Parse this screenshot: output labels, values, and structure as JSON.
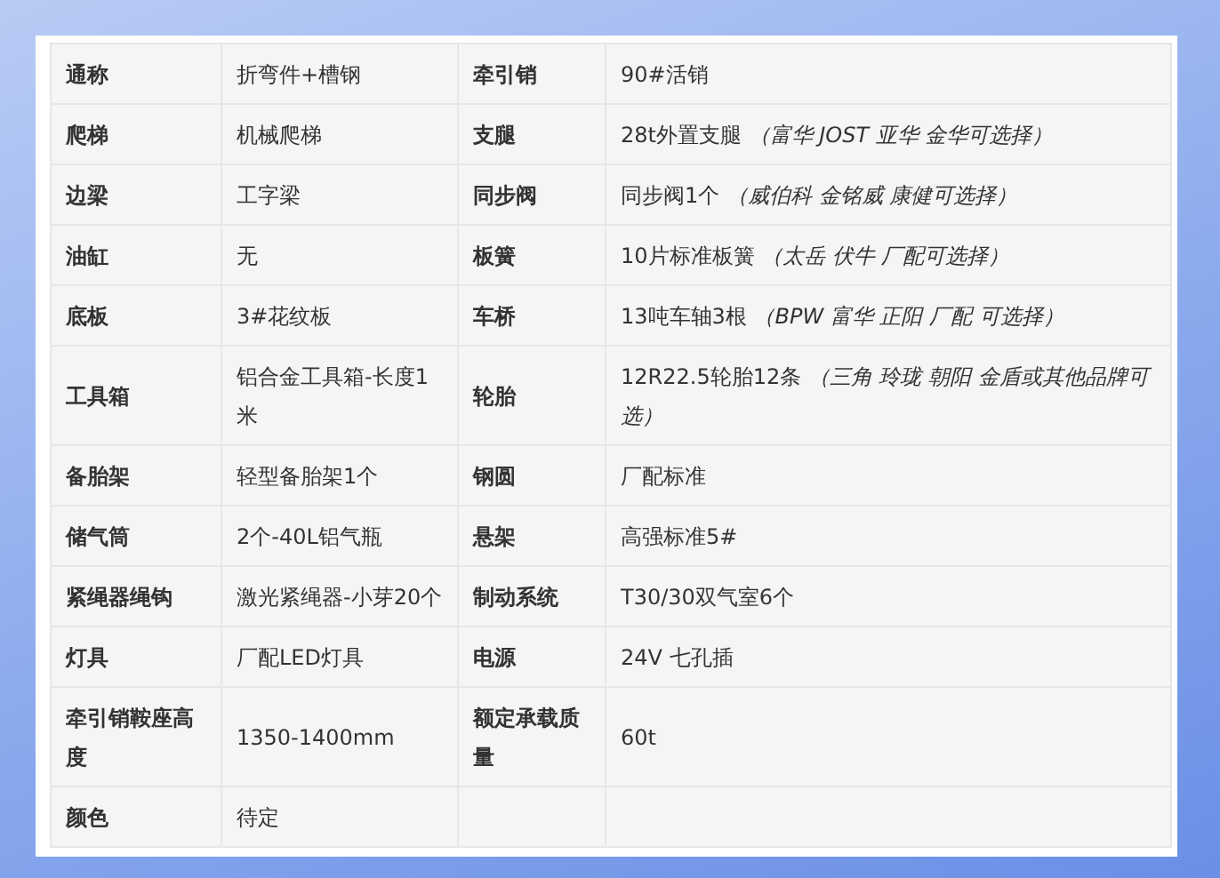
{
  "specs": [
    {
      "left": {
        "label": "通称",
        "value": "折弯件+槽钢"
      },
      "right": {
        "label": "牵引销",
        "value": "90#活销"
      }
    },
    {
      "left": {
        "label": "爬梯",
        "value": "机械爬梯"
      },
      "right": {
        "label": "支腿",
        "value": "28t外置支腿 *（富华 JOST 亚华 金华可选择）*"
      }
    },
    {
      "left": {
        "label": "边梁",
        "value": "工字梁"
      },
      "right": {
        "label": "同步阀",
        "value": "同步阀1个 *（威伯科 金铭威 康健可选择）*"
      }
    },
    {
      "left": {
        "label": "油缸",
        "value": "无"
      },
      "right": {
        "label": "板簧",
        "value": "10片标准板簧 *（太岳 伏牛 厂配可选择）*"
      }
    },
    {
      "left": {
        "label": "底板",
        "value": "3#花纹板"
      },
      "right": {
        "label": "车桥",
        "value": "13吨车轴3根 *（BPW 富华 正阳 厂配 可选择）*"
      }
    },
    {
      "left": {
        "label": "工具箱",
        "value": "铝合金工具箱-长度1米"
      },
      "right": {
        "label": "轮胎",
        "value": "12R22.5轮胎12条 *（三角 玲珑 朝阳 金盾或其他品牌可选）*"
      }
    },
    {
      "left": {
        "label": "备胎架",
        "value": "轻型备胎架1个"
      },
      "right": {
        "label": "钢圆",
        "value": "厂配标准"
      }
    },
    {
      "left": {
        "label": "储气筒",
        "value": "2个-40L铝气瓶"
      },
      "right": {
        "label": "悬架",
        "value": "高强标准5#"
      }
    },
    {
      "left": {
        "label": "紧绳器绳钩",
        "value": "激光紧绳器-小芽20个"
      },
      "right": {
        "label": "制动系统",
        "value": "T30/30双气室6个"
      }
    },
    {
      "left": {
        "label": "灯具",
        "value": "厂配LED灯具"
      },
      "right": {
        "label": "电源",
        "value": "24V 七孔插"
      }
    },
    {
      "left": {
        "label": "牵引销鞍座高度",
        "value": "1350-1400mm"
      },
      "right": {
        "label": "额定承载质量",
        "value": "60t"
      }
    },
    {
      "left": {
        "label": "颜色",
        "value": "待定"
      }
    }
  ]
}
